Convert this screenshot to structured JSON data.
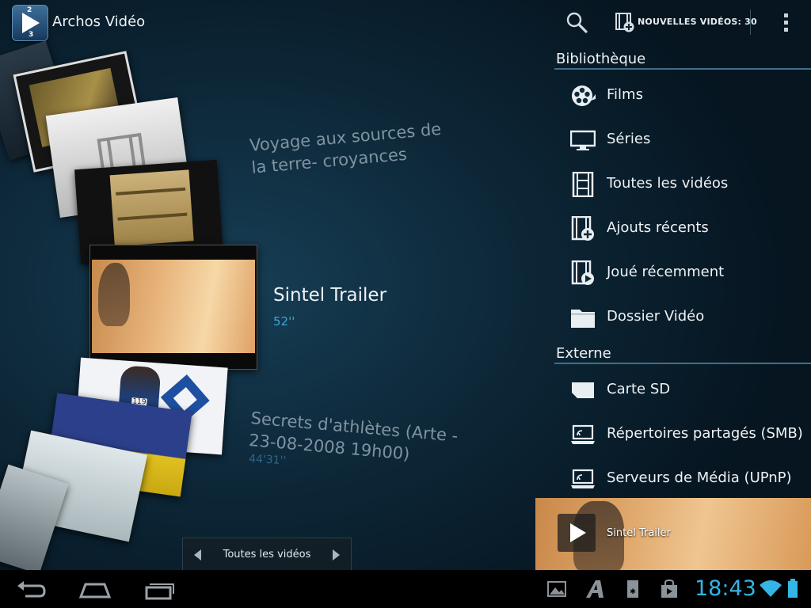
{
  "action_bar": {
    "app_title": "Archos Vidéo",
    "app_icon": "archos-video-app-icon",
    "app_icon_numbers": [
      "2",
      "3"
    ],
    "search_icon": "search-icon",
    "new_videos_label": "NOUVELLES VIDÉOS: 30",
    "overflow_icon": "overflow-menu-icon"
  },
  "carousel": {
    "upper_title": "Voyage aux sources de\nla terre- croyances",
    "focused_title": "Sintel Trailer",
    "focused_duration": "52''",
    "lower_title": "Secrets d'athlètes (Arte -\n23-08-2008 19h00)",
    "lower_duration": "44'31''",
    "card_badge": "119",
    "nav_label": "Toutes les vidéos"
  },
  "library": {
    "section_title": "Bibliothèque",
    "items": [
      {
        "label": "Films",
        "icon": "film-reel-icon"
      },
      {
        "label": "Séries",
        "icon": "tv-icon"
      },
      {
        "label": "Toutes les vidéos",
        "icon": "film-strip-icon"
      },
      {
        "label": "Ajouts récents",
        "icon": "film-add-icon"
      },
      {
        "label": "Joué récemment",
        "icon": "film-play-icon"
      },
      {
        "label": "Dossier Vidéo",
        "icon": "folder-icon"
      }
    ]
  },
  "external": {
    "section_title": "Externe",
    "items": [
      {
        "label": "Carte SD",
        "icon": "sd-card-icon"
      },
      {
        "label": "Répertoires partagés (SMB)",
        "icon": "network-laptop-icon"
      },
      {
        "label": "Serveurs de Média (UPnP)",
        "icon": "network-laptop-icon"
      }
    ]
  },
  "mini_player": {
    "title": "Sintel Trailer",
    "icon": "play-icon"
  },
  "system_bar": {
    "time": "18:43",
    "buttons": [
      "back-icon",
      "home-icon",
      "recent-apps-icon"
    ],
    "notification_icons": [
      "gallery-icon",
      "archos-a-icon",
      "sd-card-status-icon",
      "store-bag-icon"
    ],
    "status_icons": [
      "wifi-icon",
      "battery-icon"
    ]
  },
  "colors": {
    "accent": "#33b5e5",
    "background": "#0c2535",
    "section_divider": "#3f6f8a"
  }
}
